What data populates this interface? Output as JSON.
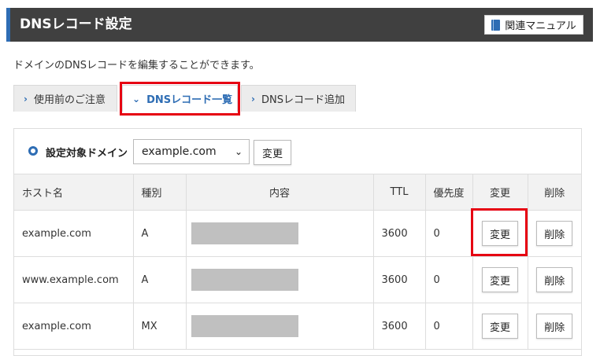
{
  "header": {
    "title": "DNSレコード設定",
    "manual_label": "関連マニュアル",
    "manual_icon": "book-icon"
  },
  "description": "ドメインのDNSレコードを編集することができます。",
  "tabs": [
    {
      "label": "使用前のご注意",
      "icon": "chevron-right-icon",
      "active": false
    },
    {
      "label": "DNSレコード一覧",
      "icon": "chevron-down-icon",
      "active": true
    },
    {
      "label": "DNSレコード追加",
      "icon": "chevron-right-icon",
      "active": false
    }
  ],
  "domain_select": {
    "label": "設定対象ドメイン",
    "value": "example.com",
    "change_label": "変更"
  },
  "table": {
    "headers": [
      "ホスト名",
      "種別",
      "内容",
      "TTL",
      "優先度",
      "変更",
      "削除"
    ],
    "rows": [
      {
        "host": "example.com",
        "type": "A",
        "ttl": "3600",
        "priority": "0",
        "edit_label": "変更",
        "delete_label": "削除"
      },
      {
        "host": "www.example.com",
        "type": "A",
        "ttl": "3600",
        "priority": "0",
        "edit_label": "変更",
        "delete_label": "削除"
      },
      {
        "host": "example.com",
        "type": "MX",
        "ttl": "3600",
        "priority": "0",
        "edit_label": "変更",
        "delete_label": "削除"
      }
    ]
  },
  "colors": {
    "accent": "#2e6db4",
    "highlight": "#e60012",
    "header_bg": "#404040"
  }
}
